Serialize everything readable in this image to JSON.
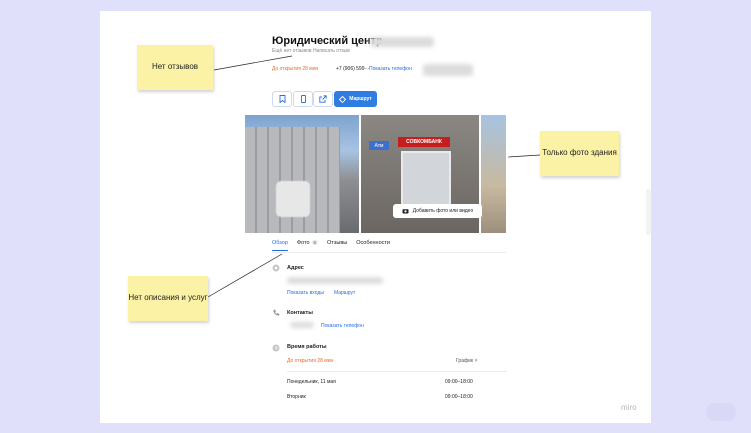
{
  "business": {
    "title": "Юридический центр",
    "reviews_note": "Ещё нет отзывов  Написать отзыв",
    "hours_status": "До открытия 28 мин",
    "phone": "+7 (906) 599···",
    "show_phone": "Показать телефон"
  },
  "actions": {
    "route": "Маршрут",
    "icons": [
      "bookmark-icon",
      "share-device-icon",
      "open-external-icon"
    ]
  },
  "photos": {
    "add_label": "Добавить фото или видео",
    "sign_text": "СОВКОМБАНК",
    "atm_text": "Атм"
  },
  "tabs": [
    {
      "label": "Обзор",
      "active": true
    },
    {
      "label": "Фото",
      "badge": "8"
    },
    {
      "label": "Отзывы"
    },
    {
      "label": "Особенности"
    }
  ],
  "address": {
    "title": "Адрес",
    "show_entrances": "Показать входы",
    "route": "Маршрут"
  },
  "contacts": {
    "title": "Контакты",
    "show_phone": "Показать телефон"
  },
  "hours": {
    "title": "Время работы",
    "status": "До открытия 28 мин",
    "schedule_toggle": "График ˄",
    "days": [
      {
        "day": "Понедельник, 11 мая",
        "time": "09:00–18:00"
      },
      {
        "day": "Вторник",
        "time": "09:00–18:00"
      }
    ]
  },
  "notes": {
    "no_reviews": "Нет отзывов",
    "only_building_photo": "Только фото здания",
    "no_description": "Нет описания и услуг"
  },
  "brand": "miro",
  "colors": {
    "background": "#e1e0fb",
    "accent": "#2f7de1",
    "status_orange": "#e86b2a",
    "sticky_note": "#fbf2a5"
  }
}
